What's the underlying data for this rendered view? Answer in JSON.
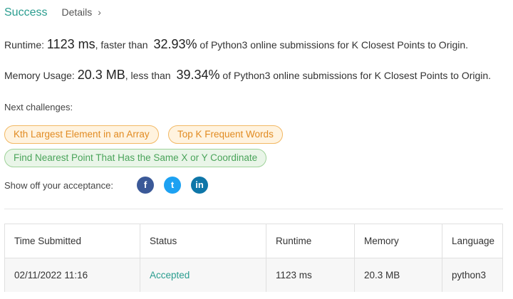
{
  "header": {
    "status": "Success",
    "details_label": "Details",
    "chevron": "›"
  },
  "runtime": {
    "label": "Runtime:",
    "value": "1123 ms",
    "mid_text": ", faster than",
    "percent": "32.93%",
    "suffix": "of Python3 online submissions for K Closest Points to Origin."
  },
  "memory": {
    "label": "Memory Usage:",
    "value": "20.3 MB",
    "mid_text": ", less than",
    "percent": "39.34%",
    "suffix": "of Python3 online submissions for K Closest Points to Origin."
  },
  "next_challenges": {
    "label": "Next challenges:",
    "items": [
      {
        "label": "Kth Largest Element in an Array",
        "difficulty_color": "orange"
      },
      {
        "label": "Top K Frequent Words",
        "difficulty_color": "orange"
      },
      {
        "label": "Find Nearest Point That Has the Same X or Y Coordinate",
        "difficulty_color": "green"
      }
    ]
  },
  "share": {
    "label": "Show off your acceptance:",
    "icons": [
      {
        "name": "facebook-icon",
        "glyph": "f",
        "color": "#3b5998"
      },
      {
        "name": "twitter-icon",
        "glyph": "t",
        "color": "#1da1f2"
      },
      {
        "name": "linkedin-icon",
        "glyph": "in",
        "color": "#0e76a8"
      }
    ]
  },
  "table": {
    "headers": [
      "Time Submitted",
      "Status",
      "Runtime",
      "Memory",
      "Language"
    ],
    "rows": [
      [
        "02/11/2022 11:16",
        "Accepted",
        "1123 ms",
        "20.3 MB",
        "python3"
      ]
    ]
  },
  "colors": {
    "success": "#2a9d8f",
    "medium_tag": "#e18b22",
    "easy_tag": "#4aa45a"
  }
}
